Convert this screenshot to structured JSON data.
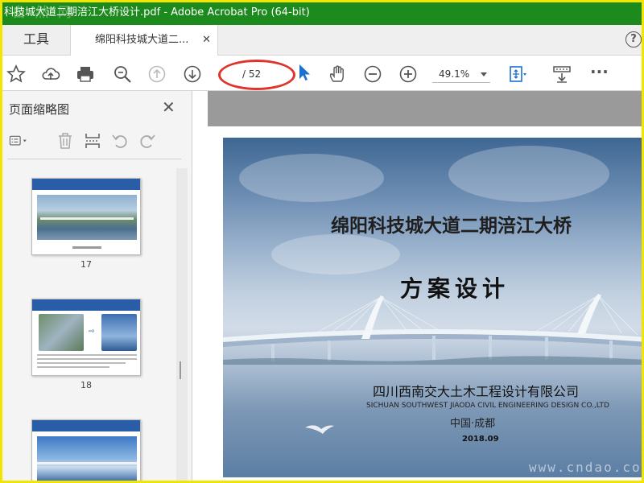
{
  "window": {
    "title": "科技城大道二期涪江大桥设计.pdf - Adobe Acrobat Pro (64-bit)",
    "watermark_top": "自 然 网"
  },
  "tabs": {
    "tools_label": "工具",
    "doc_label": "绵阳科技城大道二...",
    "close_glyph": "✕",
    "help_glyph": "?"
  },
  "toolbar": {
    "page_total": "/ 52",
    "zoom": "49.1%",
    "more_glyph": "···"
  },
  "sidebar": {
    "title": "页面缩略图",
    "close_glyph": "✕",
    "thumbnails": [
      {
        "label": "17"
      },
      {
        "label": "18"
      },
      {
        "label": ""
      }
    ]
  },
  "document": {
    "title": "绵阳科技城大道二期涪江大桥",
    "subtitle": "方案设计",
    "company_cn": "四川西南交大土木工程设计有限公司",
    "company_en": "SICHUAN SOUTHWEST JIAODA CIVIL ENGINEERING DESIGN CO.,LTD",
    "city": "中国·成都",
    "date": "2018.09"
  },
  "watermark_bottom": "www.cndao.com",
  "colors": {
    "titlebar": "#1c8a1c",
    "frame_border": "#f2e600",
    "highlight_oval": "#e0332b",
    "cursor_blue": "#1a6fd0"
  }
}
